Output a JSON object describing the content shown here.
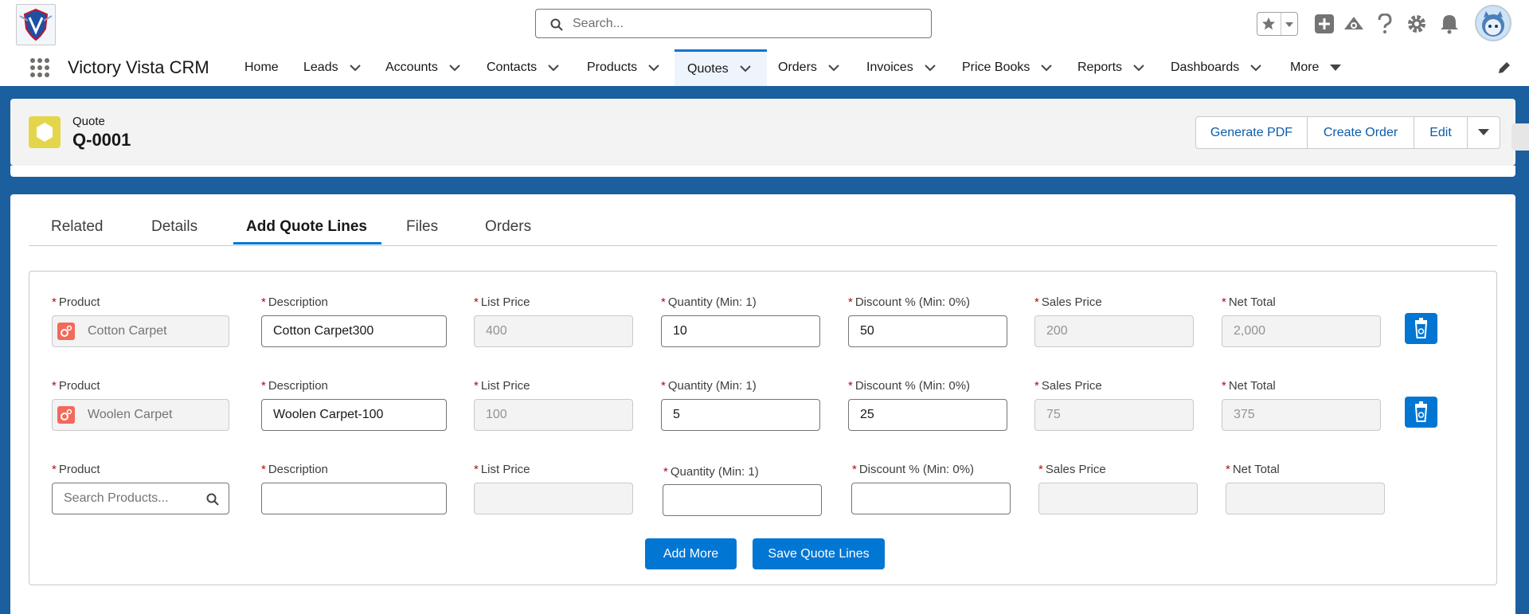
{
  "colors": {
    "brand": "#0176d3",
    "nav_bg": "#1b5f9e",
    "required": "#ba0517",
    "record_icon": "#e4d64a",
    "product_icon": "#f26a5b"
  },
  "header": {
    "search_placeholder": "Search..."
  },
  "app": {
    "name": "Victory Vista CRM"
  },
  "nav": {
    "items": [
      {
        "label": "Home",
        "has_menu": false
      },
      {
        "label": "Leads",
        "has_menu": true
      },
      {
        "label": "Accounts",
        "has_menu": true
      },
      {
        "label": "Contacts",
        "has_menu": true
      },
      {
        "label": "Products",
        "has_menu": true
      },
      {
        "label": "Quotes",
        "has_menu": true,
        "active": true
      },
      {
        "label": "Orders",
        "has_menu": true
      },
      {
        "label": "Invoices",
        "has_menu": true
      },
      {
        "label": "Price Books",
        "has_menu": true
      },
      {
        "label": "Reports",
        "has_menu": true
      },
      {
        "label": "Dashboards",
        "has_menu": true
      },
      {
        "label": "More",
        "has_menu": true
      }
    ]
  },
  "record": {
    "type": "Quote",
    "name": "Q-0001",
    "actions": [
      "Generate PDF",
      "Create Order",
      "Edit"
    ]
  },
  "tabs": [
    {
      "label": "Related"
    },
    {
      "label": "Details"
    },
    {
      "label": "Add Quote Lines",
      "active": true
    },
    {
      "label": "Files"
    },
    {
      "label": "Orders"
    }
  ],
  "form": {
    "labels": {
      "product": "Product",
      "description": "Description",
      "list_price": "List Price",
      "quantity": "Quantity (Min: 1)",
      "discount": "Discount % (Min: 0%)",
      "sales_price": "Sales Price",
      "net_total": "Net Total"
    },
    "required_mark": "*",
    "rows": [
      {
        "product": "Cotton Carpet",
        "description": "Cotton Carpet300",
        "list_price": "400",
        "quantity": "10",
        "discount": "50",
        "sales_price": "200",
        "net_total": "2,000"
      },
      {
        "product": "Woolen Carpet",
        "description": "Woolen Carpet-100",
        "list_price": "100",
        "quantity": "5",
        "discount": "25",
        "sales_price": "75",
        "net_total": "375"
      }
    ],
    "new_row": {
      "product_placeholder": "Search Products...",
      "description": "",
      "list_price": "",
      "quantity": "",
      "discount": "",
      "sales_price": "",
      "net_total": ""
    },
    "add_more_label": "Add More",
    "save_label": "Save Quote Lines"
  }
}
